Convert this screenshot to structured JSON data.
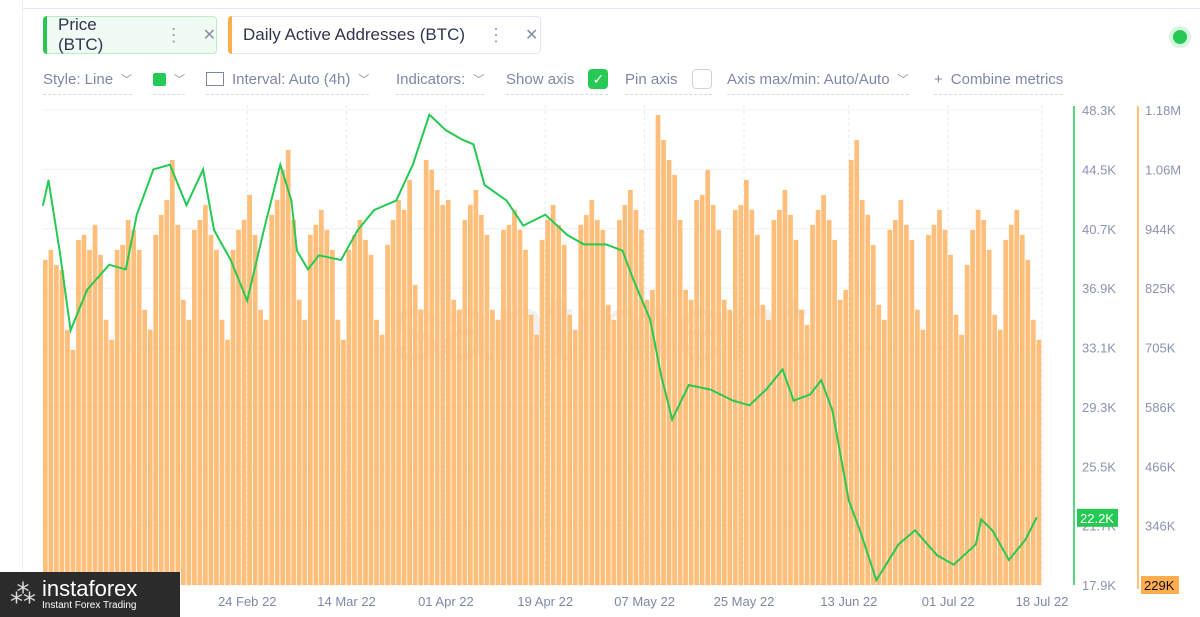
{
  "tabs": [
    {
      "label": "Price (BTC)",
      "color": "#26c953",
      "active": true
    },
    {
      "label": "Daily Active Addresses (BTC)",
      "color": "#ffad4d",
      "active": false
    }
  ],
  "toolbar": {
    "style": "Style: Line",
    "color_swatch": "#26c953",
    "interval": "Interval: Auto (4h)",
    "indicators": "Indicators:",
    "show_axis": "Show axis",
    "show_axis_checked": true,
    "pin_axis": "Pin axis",
    "pin_axis_checked": false,
    "axis_maxmin": "Axis max/min: Auto/Auto",
    "combine": "Combine metrics"
  },
  "status_dot_color": "#26c953",
  "watermark": "santiment",
  "logo": {
    "name": "instaforex",
    "tagline": "Instant Forex Trading"
  },
  "chart_data": {
    "type": "line+bar",
    "x_range": [
      "2022-01-18",
      "2022-07-18"
    ],
    "x_tick_labels": [
      {
        "date": "2022-02-24",
        "label": "24 Feb 22"
      },
      {
        "date": "2022-03-14",
        "label": "14 Mar 22"
      },
      {
        "date": "2022-04-01",
        "label": "01 Apr 22"
      },
      {
        "date": "2022-04-19",
        "label": "19 Apr 22"
      },
      {
        "date": "2022-05-07",
        "label": "07 May 22"
      },
      {
        "date": "2022-05-25",
        "label": "25 May 22"
      },
      {
        "date": "2022-06-13",
        "label": "13 Jun 22"
      },
      {
        "date": "2022-07-01",
        "label": "01 Jul 22"
      },
      {
        "date": "2022-07-18",
        "label": "18 Jul 22"
      }
    ],
    "grid": true,
    "series": [
      {
        "name": "Price (BTC)",
        "type": "line",
        "color": "#26c953",
        "unit": "K USD",
        "ylim": [
          17.9,
          48.3
        ],
        "y_tick_labels": [
          "48.3K",
          "44.5K",
          "40.7K",
          "36.9K",
          "33.1K",
          "29.3K",
          "25.5K",
          "21.7K",
          "17.9K"
        ],
        "last_value_label": "22.2K",
        "x": [
          "2022-01-18",
          "2022-01-19",
          "2022-01-21",
          "2022-01-23",
          "2022-01-26",
          "2022-01-30",
          "2022-02-02",
          "2022-02-04",
          "2022-02-07",
          "2022-02-10",
          "2022-02-13",
          "2022-02-16",
          "2022-02-18",
          "2022-02-21",
          "2022-02-24",
          "2022-02-27",
          "2022-03-02",
          "2022-03-04",
          "2022-03-05",
          "2022-03-07",
          "2022-03-09",
          "2022-03-13",
          "2022-03-16",
          "2022-03-19",
          "2022-03-23",
          "2022-03-26",
          "2022-03-29",
          "2022-04-01",
          "2022-04-04",
          "2022-04-06",
          "2022-04-08",
          "2022-04-12",
          "2022-04-15",
          "2022-04-19",
          "2022-04-23",
          "2022-04-26",
          "2022-04-30",
          "2022-05-03",
          "2022-05-05",
          "2022-05-08",
          "2022-05-10",
          "2022-05-12",
          "2022-05-15",
          "2022-05-19",
          "2022-05-23",
          "2022-05-26",
          "2022-05-29",
          "2022-06-01",
          "2022-06-03",
          "2022-06-06",
          "2022-06-08",
          "2022-06-10",
          "2022-06-13",
          "2022-06-15",
          "2022-06-18",
          "2022-06-22",
          "2022-06-25",
          "2022-06-29",
          "2022-07-02",
          "2022-07-06",
          "2022-07-07",
          "2022-07-09",
          "2022-07-12",
          "2022-07-15",
          "2022-07-17"
        ],
        "values": [
          42.2,
          43.8,
          39.3,
          34.2,
          36.8,
          38.4,
          38.1,
          41.6,
          44.5,
          44.8,
          42.2,
          44.5,
          40.6,
          38.7,
          36.1,
          40.6,
          44.8,
          42.5,
          39.3,
          38.1,
          39.0,
          38.7,
          40.6,
          41.9,
          42.5,
          44.8,
          48.0,
          47.0,
          46.4,
          46.1,
          43.5,
          42.5,
          40.9,
          41.6,
          40.3,
          39.7,
          39.7,
          39.3,
          37.4,
          34.9,
          31.3,
          28.5,
          30.7,
          30.4,
          29.7,
          29.4,
          30.4,
          31.7,
          29.7,
          30.1,
          31.0,
          29.1,
          23.3,
          21.4,
          18.2,
          20.5,
          21.4,
          19.8,
          19.2,
          20.5,
          22.1,
          21.4,
          19.5,
          20.8,
          22.2
        ]
      },
      {
        "name": "Daily Active Addresses (BTC)",
        "type": "bar",
        "color": "#ffad4d",
        "unit": "K",
        "ylim": [
          229,
          1180
        ],
        "y_tick_labels": [
          "1.18M",
          "1.06M",
          "944K",
          "825K",
          "705K",
          "586K",
          "466K",
          "346K"
        ],
        "last_value_label": "229K",
        "start_date": "2022-01-18",
        "interval": "1d",
        "values": [
          880,
          900,
          870,
          860,
          740,
          700,
          920,
          930,
          900,
          950,
          890,
          760,
          720,
          900,
          910,
          960,
          940,
          900,
          780,
          740,
          930,
          970,
          1000,
          1080,
          950,
          800,
          760,
          940,
          960,
          990,
          930,
          900,
          760,
          720,
          900,
          940,
          960,
          1010,
          930,
          780,
          760,
          970,
          1000,
          1060,
          1100,
          960,
          800,
          760,
          930,
          950,
          980,
          940,
          900,
          760,
          720,
          900,
          930,
          960,
          920,
          890,
          760,
          730,
          910,
          960,
          1000,
          980,
          1040,
          830,
          780,
          1080,
          1060,
          1020,
          990,
          1000,
          800,
          780,
          960,
          990,
          1020,
          970,
          930,
          780,
          760,
          940,
          950,
          980,
          940,
          900,
          770,
          730,
          920,
          960,
          990,
          950,
          910,
          770,
          740,
          950,
          970,
          1000,
          960,
          940,
          790,
          760,
          960,
          990,
          1020,
          980,
          940,
          800,
          820,
          1170,
          1120,
          1080,
          1050,
          960,
          820,
          800,
          1000,
          1010,
          1060,
          990,
          940,
          800,
          780,
          980,
          990,
          1040,
          980,
          930,
          790,
          760,
          960,
          980,
          1020,
          970,
          920,
          780,
          750,
          950,
          980,
          1010,
          960,
          920,
          800,
          820,
          1080,
          1120,
          1000,
          970,
          910,
          790,
          760,
          940,
          960,
          1000,
          950,
          920,
          780,
          740,
          930,
          950,
          980,
          940,
          890,
          770,
          730,
          870,
          940,
          980,
          960,
          900,
          770,
          740,
          920,
          950,
          980,
          930,
          880,
          760,
          720
        ]
      }
    ]
  }
}
